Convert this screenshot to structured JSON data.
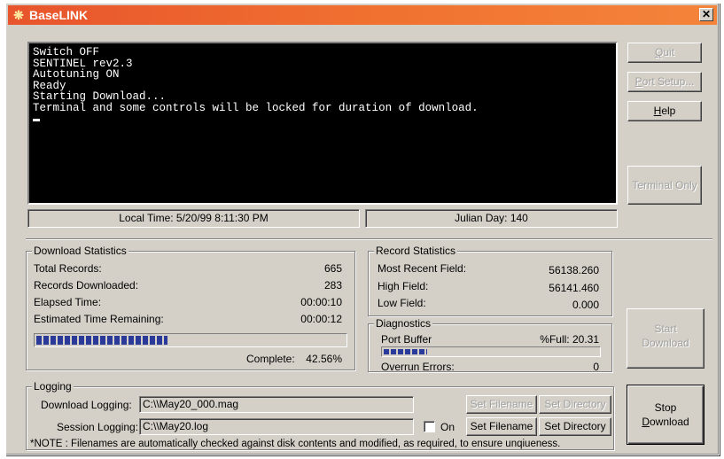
{
  "window": {
    "title": "BaseLINK",
    "close_label": "✕"
  },
  "terminal": {
    "lines": [
      "Switch OFF",
      "SENTINEL rev2.3",
      "Autotuning ON",
      "Ready",
      "Starting Download...",
      "Terminal and some controls will be locked for duration of download."
    ]
  },
  "status": {
    "local_time": "Local Time: 5/20/99 8:11:30 PM",
    "julian_day": "Julian Day: 140"
  },
  "buttons": {
    "quit": {
      "first": "Q",
      "rest": "uit"
    },
    "port_setup": {
      "first": "P",
      "rest": "ort Setup..."
    },
    "help": {
      "first": "H",
      "rest": "elp"
    },
    "terminal_only": "Terminal Only",
    "start_line1": "Start",
    "start_line2": "Download",
    "stop_line1": "Stop",
    "stop_first": "D",
    "stop_rest": "ownload"
  },
  "download_statistics": {
    "title": "Download Statistics",
    "rows": [
      {
        "label": "Total Records:",
        "value": "665"
      },
      {
        "label": "Records Downloaded:",
        "value": "283"
      },
      {
        "label": "Elapsed Time:",
        "value": "00:00:10"
      },
      {
        "label": "Estimated Time Remaining:",
        "value": "00:00:12"
      }
    ],
    "progress_fraction": 0.4256,
    "complete_label": "Complete:",
    "complete_value": "42.56%"
  },
  "record_statistics": {
    "title": "Record Statistics",
    "rows": [
      {
        "label": "Most Recent Field:",
        "value": "56138.260"
      },
      {
        "label": "High Field:",
        "value": "56141.460"
      },
      {
        "label": "Low Field:",
        "value": "0.000"
      }
    ]
  },
  "diagnostics": {
    "title": "Diagnostics",
    "port_buffer_label": "Port Buffer",
    "port_buffer_value": "%Full: 20.31",
    "port_buffer_fraction": 0.2031,
    "overrun_label": "Overrun Errors:",
    "overrun_value": "0"
  },
  "logging": {
    "title": "Logging",
    "download_label": "Download Logging:",
    "download_value": "C:\\\\May20_000.mag",
    "session_label": "Session Logging:",
    "session_value": "C:\\\\May20.log",
    "on_label": "On",
    "set_filename": "Set Filename",
    "set_directory": "Set Directory",
    "note": "*NOTE : Filenames are automatically checked against disk contents and modified, as required, to ensure unqiueness."
  }
}
